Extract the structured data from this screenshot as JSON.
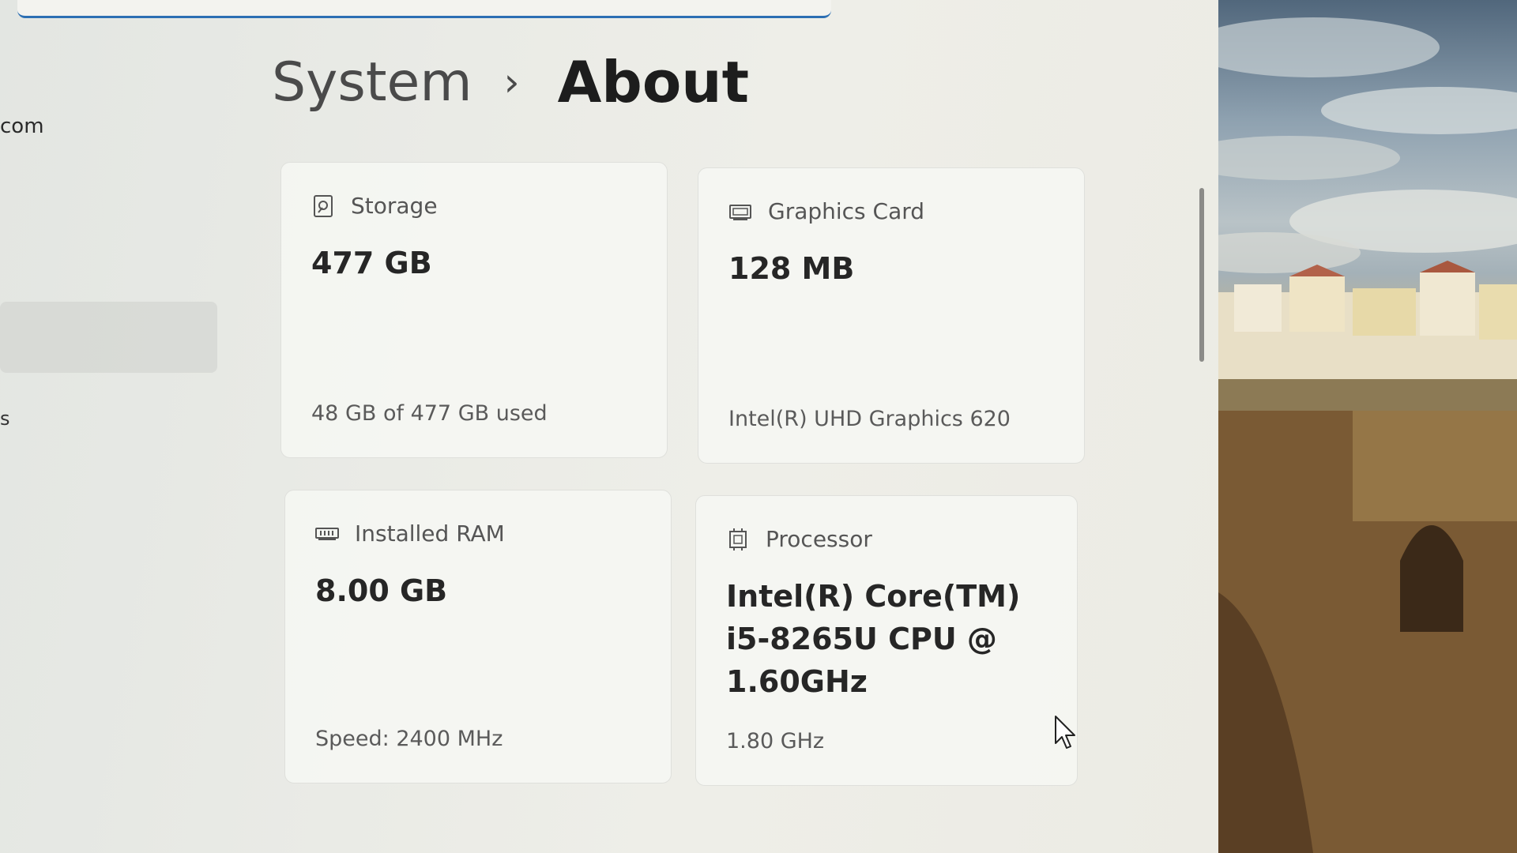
{
  "header": {
    "account_email": "com",
    "nav_peek": "s"
  },
  "breadcrumb": {
    "parent": "System",
    "separator": "›",
    "current": "About"
  },
  "cards": {
    "storage": {
      "icon": "storage-icon",
      "title": "Storage",
      "value": "477 GB",
      "detail": "48 GB of 477 GB used"
    },
    "graphics": {
      "icon": "graphics-card-icon",
      "title": "Graphics Card",
      "value": "128 MB",
      "detail": "Intel(R) UHD Graphics 620"
    },
    "ram": {
      "icon": "ram-icon",
      "title": "Installed RAM",
      "value": "8.00 GB",
      "detail": "Speed: 2400 MHz"
    },
    "processor": {
      "icon": "processor-icon",
      "title": "Processor",
      "value": "Intel(R) Core(TM) i5-8265U CPU @ 1.60GHz",
      "detail": "1.80 GHz"
    }
  },
  "colors": {
    "accent": "#2c6fb3",
    "window_bg": "#eaebe6",
    "card_bg": "#f7f8f5"
  }
}
